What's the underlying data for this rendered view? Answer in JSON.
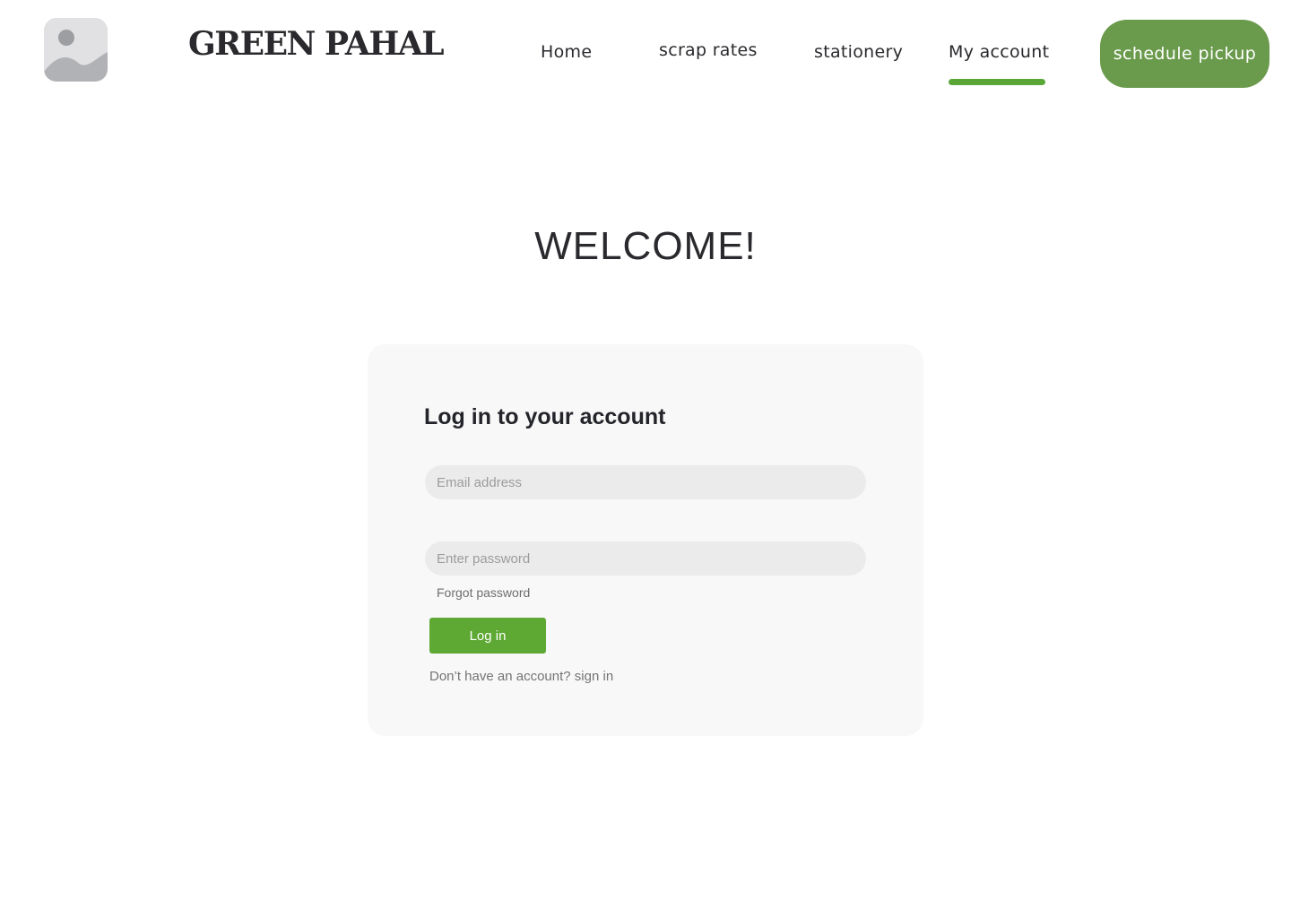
{
  "header": {
    "logo_icon": "image-placeholder-icon",
    "brand": "GREEN PAHAL",
    "nav": {
      "home": "Home",
      "scrap_rates": "scrap rates",
      "stationery": "stationery",
      "my_account": "My account"
    },
    "active_nav": "My account",
    "cta_label": "schedule pickup"
  },
  "main": {
    "welcome": "WELCOME!",
    "login_card": {
      "title": "Log in to your account",
      "email_placeholder": "Email address",
      "email_value": "",
      "password_placeholder": "Enter password",
      "password_value": "",
      "forgot_password": "Forgot password",
      "login_button": "Log in",
      "no_account_text": "Don’t have an account?",
      "sign_in_link": "sign in"
    }
  },
  "colors": {
    "accent_green": "#5ea934",
    "cta_green": "#6a9a4c",
    "card_background": "#f8f8f8",
    "field_background": "#ebebeb"
  }
}
